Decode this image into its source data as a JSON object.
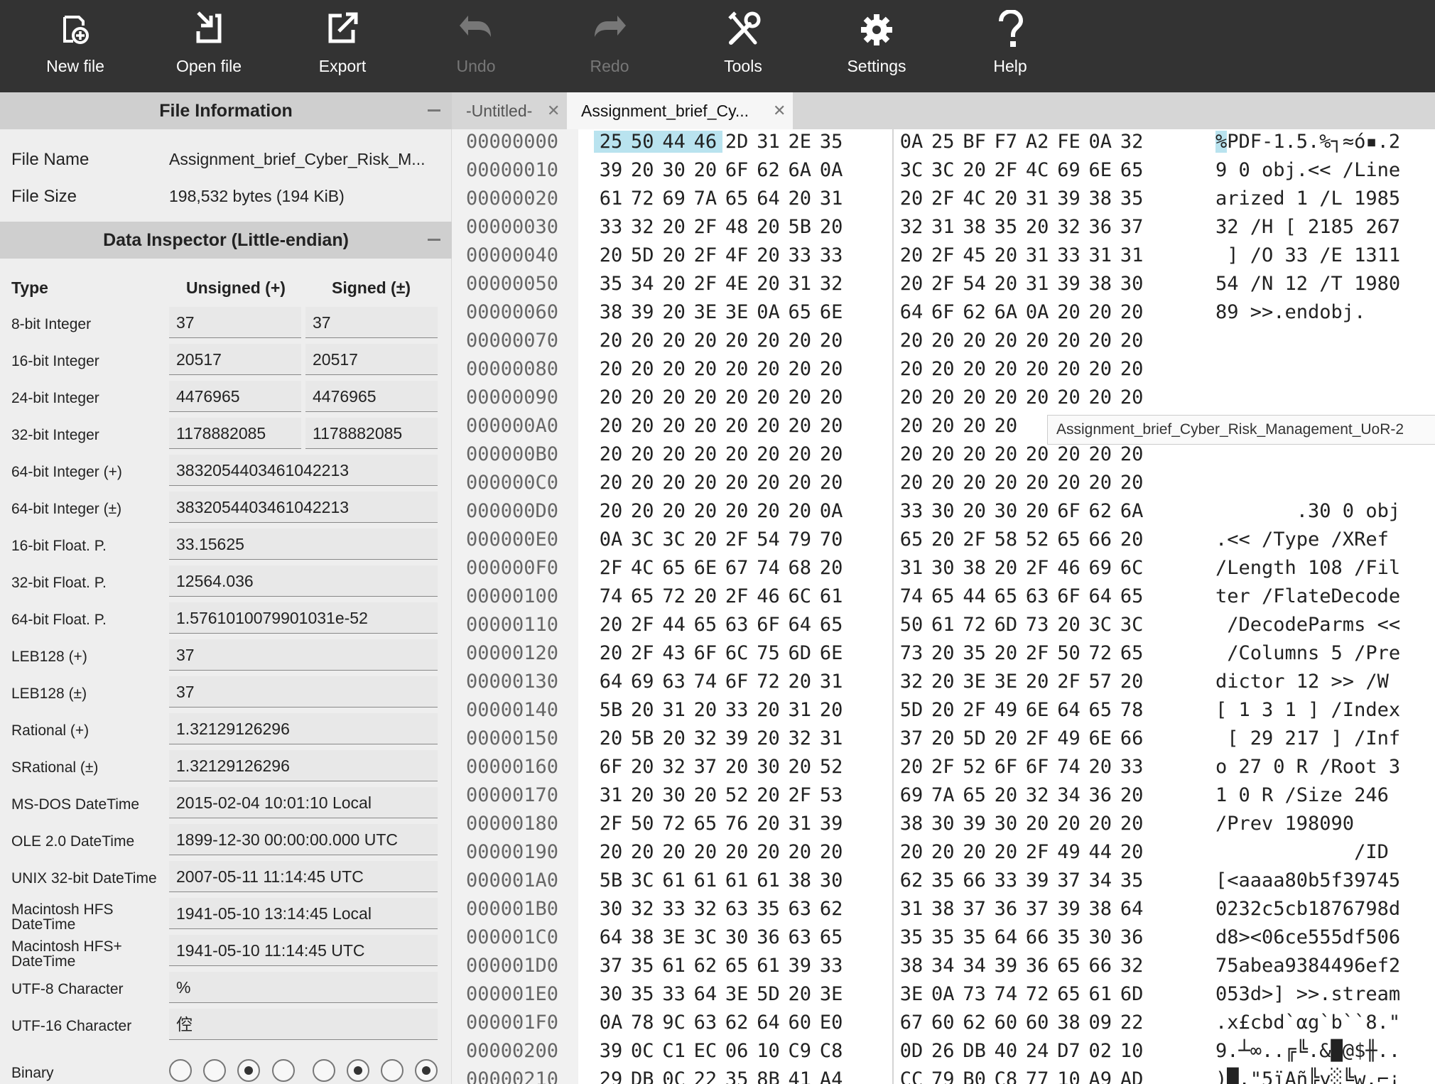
{
  "toolbar": {
    "new_file": "New file",
    "open_file": "Open file",
    "export": "Export",
    "undo": "Undo",
    "redo": "Redo",
    "tools": "Tools",
    "settings": "Settings",
    "help": "Help"
  },
  "file_info": {
    "title": "File Information",
    "name_label": "File Name",
    "name_value": "Assignment_brief_Cyber_Risk_M...",
    "size_label": "File Size",
    "size_value": "198,532 bytes (194 KiB)"
  },
  "data_inspector": {
    "title": "Data Inspector (Little-endian)",
    "col_type": "Type",
    "col_unsigned": "Unsigned (+)",
    "col_signed": "Signed (±)",
    "rows": [
      {
        "label": "8-bit Integer",
        "unsigned": "37",
        "signed": "37"
      },
      {
        "label": "16-bit Integer",
        "unsigned": "20517",
        "signed": "20517"
      },
      {
        "label": "24-bit Integer",
        "unsigned": "4476965",
        "signed": "4476965"
      },
      {
        "label": "32-bit Integer",
        "unsigned": "1178882085",
        "signed": "1178882085"
      },
      {
        "label": "64-bit Integer (+)",
        "value": "3832054403461042213"
      },
      {
        "label": "64-bit Integer (±)",
        "value": "3832054403461042213"
      },
      {
        "label": "16-bit Float. P.",
        "value": "33.15625"
      },
      {
        "label": "32-bit Float. P.",
        "value": "12564.036"
      },
      {
        "label": "64-bit Float. P.",
        "value": "1.5761010079901031e-52"
      },
      {
        "label": "LEB128 (+)",
        "value": "37"
      },
      {
        "label": "LEB128 (±)",
        "value": "37"
      },
      {
        "label": "Rational (+)",
        "value": "1.32129126296"
      },
      {
        "label": "SRational (±)",
        "value": "1.32129126296"
      },
      {
        "label": "MS-DOS DateTime",
        "value": "2015-02-04 10:01:10 Local"
      },
      {
        "label": "OLE 2.0 DateTime",
        "value": "1899-12-30 00:00:00.000 UTC"
      },
      {
        "label": "UNIX 32-bit DateTime",
        "value": "2007-05-11 11:14:45 UTC"
      },
      {
        "label": "Macintosh HFS",
        "label2": "DateTime",
        "value": "1941-05-10 13:14:45 Local"
      },
      {
        "label": "Macintosh HFS+",
        "label2": "DateTime",
        "value": "1941-05-10 11:14:45 UTC"
      },
      {
        "label": "UTF-8 Character",
        "value": "%"
      },
      {
        "label": "UTF-16 Character",
        "value": "倥"
      }
    ],
    "binary_label": "Binary",
    "binary_bits": [
      0,
      0,
      1,
      0,
      0,
      1,
      0,
      1
    ]
  },
  "tabs": [
    {
      "label": "-Untitled-",
      "active": false
    },
    {
      "label": "Assignment_brief_Cy...",
      "active": true
    }
  ],
  "tooltip": "Assignment_brief_Cyber_Risk_Management_UoR-2",
  "hex_rows": [
    {
      "addr": "00000000",
      "bytes": "25 50 44 46 2D 31 2E 35 0A 25 BF F7 A2 FE 0A 32",
      "ascii": "%PDF-1.5.%┐≈ó▪.2"
    },
    {
      "addr": "00000010",
      "bytes": "39 20 30 20 6F 62 6A 0A 3C 3C 20 2F 4C 69 6E 65",
      "ascii": "9 0 obj.<< /Line"
    },
    {
      "addr": "00000020",
      "bytes": "61 72 69 7A 65 64 20 31 20 2F 4C 20 31 39 38 35",
      "ascii": "arized 1 /L 1985"
    },
    {
      "addr": "00000030",
      "bytes": "33 32 20 2F 48 20 5B 20 32 31 38 35 20 32 36 37",
      "ascii": "32 /H [ 2185 267"
    },
    {
      "addr": "00000040",
      "bytes": "20 5D 20 2F 4F 20 33 33 20 2F 45 20 31 33 31 31",
      "ascii": " ] /O 33 /E 1311"
    },
    {
      "addr": "00000050",
      "bytes": "35 34 20 2F 4E 20 31 32 20 2F 54 20 31 39 38 30",
      "ascii": "54 /N 12 /T 1980"
    },
    {
      "addr": "00000060",
      "bytes": "38 39 20 3E 3E 0A 65 6E 64 6F 62 6A 0A 20 20 20",
      "ascii": "89 >>.endobj.   "
    },
    {
      "addr": "00000070",
      "bytes": "20 20 20 20 20 20 20 20 20 20 20 20 20 20 20 20",
      "ascii": ""
    },
    {
      "addr": "00000080",
      "bytes": "20 20 20 20 20 20 20 20 20 20 20 20 20 20 20 20",
      "ascii": ""
    },
    {
      "addr": "00000090",
      "bytes": "20 20 20 20 20 20 20 20 20 20 20 20 20 20 20 20",
      "ascii": ""
    },
    {
      "addr": "000000A0",
      "bytes": "20 20 20 20 20 20 20 20 20 20 20 20",
      "ascii": ""
    },
    {
      "addr": "000000B0",
      "bytes": "20 20 20 20 20 20 20 20 20 20 20 20 20 20 20 20",
      "ascii": ""
    },
    {
      "addr": "000000C0",
      "bytes": "20 20 20 20 20 20 20 20 20 20 20 20 20 20 20 20",
      "ascii": ""
    },
    {
      "addr": "000000D0",
      "bytes": "20 20 20 20 20 20 20 0A 33 30 20 30 20 6F 62 6A",
      "ascii": "       .30 0 obj"
    },
    {
      "addr": "000000E0",
      "bytes": "0A 3C 3C 20 2F 54 79 70 65 20 2F 58 52 65 66 20",
      "ascii": ".<< /Type /XRef "
    },
    {
      "addr": "000000F0",
      "bytes": "2F 4C 65 6E 67 74 68 20 31 30 38 20 2F 46 69 6C",
      "ascii": "/Length 108 /Fil"
    },
    {
      "addr": "00000100",
      "bytes": "74 65 72 20 2F 46 6C 61 74 65 44 65 63 6F 64 65",
      "ascii": "ter /FlateDecode"
    },
    {
      "addr": "00000110",
      "bytes": "20 2F 44 65 63 6F 64 65 50 61 72 6D 73 20 3C 3C",
      "ascii": " /DecodeParms <<"
    },
    {
      "addr": "00000120",
      "bytes": "20 2F 43 6F 6C 75 6D 6E 73 20 35 20 2F 50 72 65",
      "ascii": " /Columns 5 /Pre"
    },
    {
      "addr": "00000130",
      "bytes": "64 69 63 74 6F 72 20 31 32 20 3E 3E 20 2F 57 20",
      "ascii": "dictor 12 >> /W "
    },
    {
      "addr": "00000140",
      "bytes": "5B 20 31 20 33 20 31 20 5D 20 2F 49 6E 64 65 78",
      "ascii": "[ 1 3 1 ] /Index"
    },
    {
      "addr": "00000150",
      "bytes": "20 5B 20 32 39 20 32 31 37 20 5D 20 2F 49 6E 66",
      "ascii": " [ 29 217 ] /Inf"
    },
    {
      "addr": "00000160",
      "bytes": "6F 20 32 37 20 30 20 52 20 2F 52 6F 6F 74 20 33",
      "ascii": "o 27 0 R /Root 3"
    },
    {
      "addr": "00000170",
      "bytes": "31 20 30 20 52 20 2F 53 69 7A 65 20 32 34 36 20",
      "ascii": "1 0 R /Size 246 "
    },
    {
      "addr": "00000180",
      "bytes": "2F 50 72 65 76 20 31 39 38 30 39 30 20 20 20 20",
      "ascii": "/Prev 198090    "
    },
    {
      "addr": "00000190",
      "bytes": "20 20 20 20 20 20 20 20 20 20 20 20 2F 49 44 20",
      "ascii": "            /ID "
    },
    {
      "addr": "000001A0",
      "bytes": "5B 3C 61 61 61 61 38 30 62 35 66 33 39 37 34 35",
      "ascii": "[<aaaa80b5f39745"
    },
    {
      "addr": "000001B0",
      "bytes": "30 32 33 32 63 35 63 62 31 38 37 36 37 39 38 64",
      "ascii": "0232c5cb1876798d"
    },
    {
      "addr": "000001C0",
      "bytes": "64 38 3E 3C 30 36 63 65 35 35 35 64 66 35 30 36",
      "ascii": "d8><06ce555df506"
    },
    {
      "addr": "000001D0",
      "bytes": "37 35 61 62 65 61 39 33 38 34 34 39 36 65 66 32",
      "ascii": "75abea9384496ef2"
    },
    {
      "addr": "000001E0",
      "bytes": "30 35 33 64 3E 5D 20 3E 3E 0A 73 74 72 65 61 6D",
      "ascii": "053d>] >>.stream"
    },
    {
      "addr": "000001F0",
      "bytes": "0A 78 9C 63 62 64 60 E0 67 60 62 60 60 38 09 22",
      "ascii": ".x£cbd`αg`b``8.\""
    },
    {
      "addr": "00000200",
      "bytes": "39 0C C1 EC 06 10 C9 C8 0D 26 DB 40 24 D7 02 10",
      "ascii": "9.┴∞..╔╚.&█@$╫.."
    },
    {
      "addr": "00000210",
      "bytes": "29 DB 0C 22 35 8B 41 A4 CC 79 B0 C8 77 10 A9 AD",
      "ascii": ")█.\"5ïAñ╠y░╚w.⌐¡"
    }
  ],
  "colors": {
    "toolbar_bg": "#333333",
    "selection": "#b9e3ef",
    "panel_header": "#cfcfcf"
  },
  "icons": [
    "new-file-icon",
    "open-file-icon",
    "export-icon",
    "undo-icon",
    "redo-icon",
    "tools-icon",
    "settings-icon",
    "help-icon"
  ]
}
